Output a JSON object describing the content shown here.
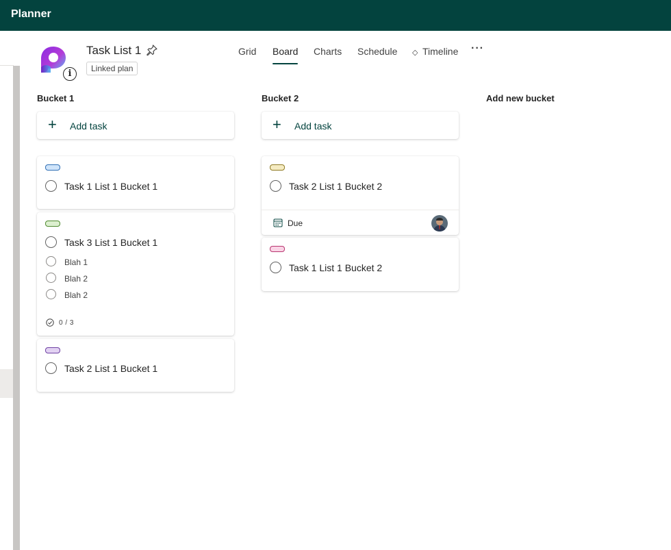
{
  "app": {
    "title": "Planner"
  },
  "plan": {
    "title": "Task List 1",
    "badge": "Linked plan",
    "logo_icon": "planner-logo-icon",
    "info_icon": "info-icon",
    "pin_icon": "pin-icon"
  },
  "tabs": [
    {
      "label": "Grid",
      "active": false
    },
    {
      "label": "Board",
      "active": true
    },
    {
      "label": "Charts",
      "active": false
    },
    {
      "label": "Schedule",
      "active": false
    },
    {
      "label": "Timeline",
      "active": false,
      "icon": "diamond-icon"
    }
  ],
  "more_glyph": "···",
  "info_glyph": "i",
  "buckets": [
    {
      "name": "Bucket 1",
      "add_task_label": "Add task",
      "tasks": [
        {
          "title": "Task 1 List 1 Bucket 1",
          "tag_color": "#cfe4fa",
          "tag_border": "#2f6fb5"
        },
        {
          "title": "Task 3 List 1 Bucket 1",
          "tag_color": "#dcefcf",
          "tag_border": "#4f8a2f",
          "checklist": [
            "Blah 1",
            "Blah 2",
            "Blah 2"
          ],
          "checklist_progress": "0 / 3"
        },
        {
          "title": "Task 2 List 1 Bucket 1",
          "tag_color": "#e2d2f2",
          "tag_border": "#6e3fa3"
        }
      ]
    },
    {
      "name": "Bucket 2",
      "add_task_label": "Add task",
      "tasks": [
        {
          "title": "Task 2 List 1 Bucket 2",
          "tag_color": "#f5ebc2",
          "tag_border": "#8f7a23",
          "due_label": "Due",
          "assignee": "avatar"
        },
        {
          "title": "Task 1 List 1 Bucket 2",
          "tag_color": "#fad4e6",
          "tag_border": "#b8356f"
        }
      ]
    }
  ],
  "add_bucket_label": "Add new bucket",
  "colors": {
    "brand": "#03433e",
    "accent_text": "#03433e"
  }
}
